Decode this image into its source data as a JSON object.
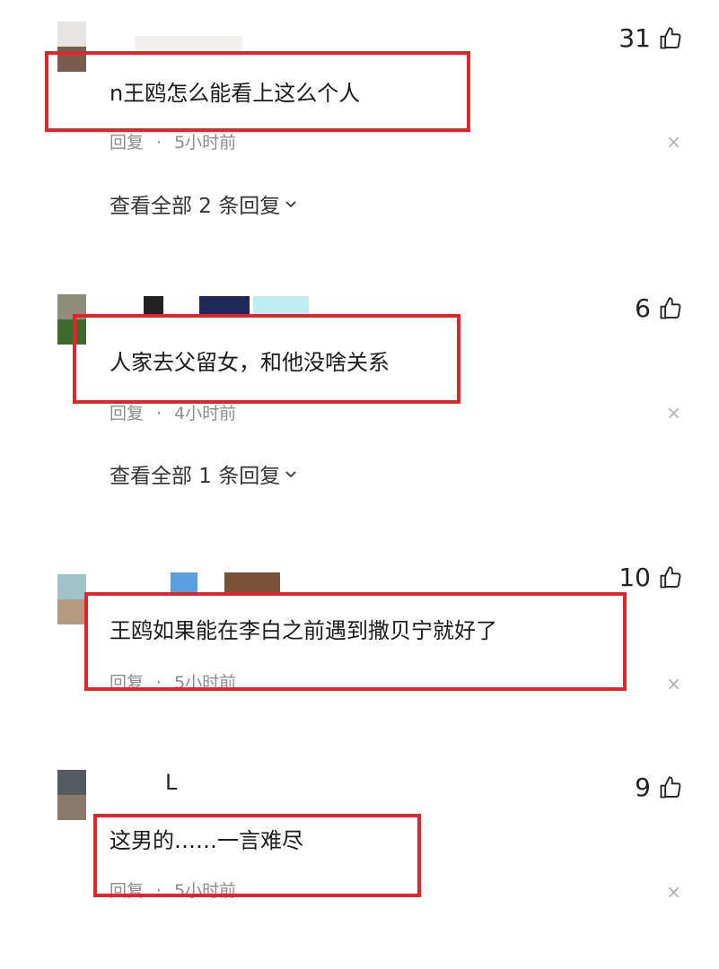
{
  "comments": [
    {
      "text": "n王鸥怎么能看上这么个人",
      "likes": "31",
      "reply": "回复",
      "dot": "·",
      "time": "5小时前",
      "view_all": "查看全部 2 条回复",
      "close": "×"
    },
    {
      "text": "人家去父留女，和他没啥关系",
      "likes": "6",
      "reply": "回复",
      "dot": "·",
      "time": "4小时前",
      "view_all": "查看全部 1 条回复",
      "close": "×"
    },
    {
      "text": "王鸥如果能在李白之前遇到撒贝宁就好了",
      "likes": "10",
      "reply": "回复",
      "dot": "·",
      "time": "5小时前",
      "close": "×"
    },
    {
      "text": "这男的……一言难尽",
      "likes": "9",
      "reply": "回复",
      "dot": "·",
      "time": "5小时前",
      "name_fragment": "L",
      "close": "×"
    }
  ],
  "colors": {
    "highlight": "#e0262a",
    "muted": "#8c8c8c"
  },
  "icons": {
    "like": "thumbs-up-icon",
    "expand": "chevron-down-icon",
    "dismiss": "close-icon"
  }
}
